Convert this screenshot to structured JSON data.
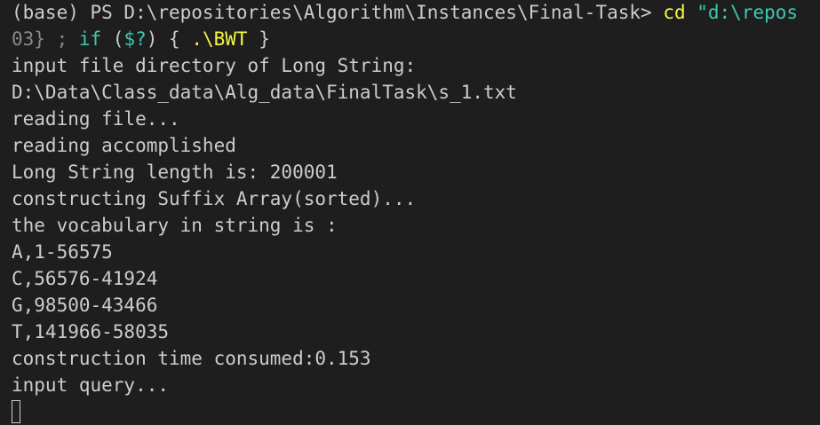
{
  "terminal": {
    "prompt_line": {
      "prompt": "(base) PS D:\\repositories\\Algorithm\\Instances\\Final-Task> ",
      "cmd": "cd",
      "arg": " \"d:\\repos"
    },
    "continuation_line": {
      "part1": "03} ; ",
      "kw_if": "if",
      "part2": " (",
      "var": "$?",
      "part3": ") { ",
      "exe": ".\\BWT",
      "part4": " }"
    },
    "output_lines": [
      "input file directory of Long String:",
      "D:\\Data\\Class_data\\Alg_data\\FinalTask\\s_1.txt",
      "reading file...",
      "reading accomplished",
      "Long String length is: 200001",
      "constructing Suffix Array(sorted)...",
      "the vocabulary in string is :",
      "A,1-56575",
      "C,56576-41924",
      "G,98500-43466",
      "T,141966-58035",
      "construction time consumed:0.153",
      "input query..."
    ]
  }
}
